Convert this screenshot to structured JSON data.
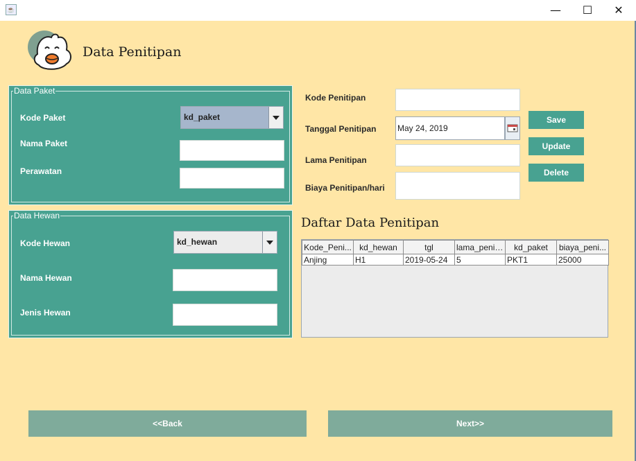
{
  "window": {
    "minimize": "—",
    "maximize": "☐",
    "close": "✕"
  },
  "header": {
    "title": "Data Penitipan"
  },
  "paket": {
    "legend": "Data Paket",
    "kode_label": "Kode Paket",
    "kode_value": "kd_paket",
    "nama_label": "Nama Paket",
    "nama_value": "",
    "perawatan_label": "Perawatan",
    "perawatan_value": ""
  },
  "hewan": {
    "legend": "Data Hewan",
    "kode_label": "Kode Hewan",
    "kode_value": "kd_hewan",
    "nama_label": "Nama Hewan",
    "nama_value": "",
    "jenis_label": "Jenis Hewan",
    "jenis_value": ""
  },
  "penitipan": {
    "kode_label": "Kode Penitipan",
    "kode_value": "",
    "tanggal_label": "Tanggal Penitipan",
    "tanggal_value": "May 24, 2019",
    "lama_label": "Lama Penitipan",
    "lama_value": "",
    "biaya_label": "Biaya Penitipan/hari",
    "biaya_value": ""
  },
  "buttons": {
    "save": "Save",
    "update": "Update",
    "delete": "Delete",
    "back": "<<Back",
    "next": "Next>>"
  },
  "table": {
    "title": "Daftar Data Penitipan",
    "columns": [
      "Kode_Peni...",
      "kd_hewan",
      "tgl",
      "lama_penit...",
      "kd_paket",
      "biaya_peni..."
    ],
    "rows": [
      [
        "Anjing",
        "H1",
        "2019-05-24",
        "5",
        "PKT1",
        "25000"
      ]
    ]
  },
  "colors": {
    "background": "#ffe6a6",
    "panel": "#48a291",
    "nav_button": "#7fab9b"
  }
}
